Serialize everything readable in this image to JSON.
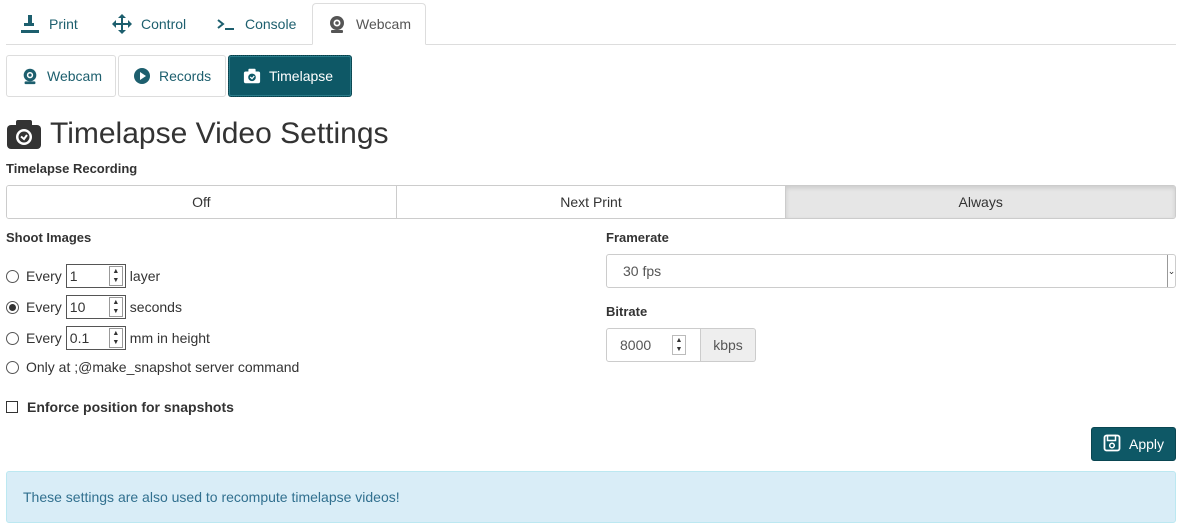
{
  "main_tabs": [
    {
      "label": "Print",
      "icon": "print-icon"
    },
    {
      "label": "Control",
      "icon": "move-arrows-icon"
    },
    {
      "label": "Console",
      "icon": "terminal-icon"
    },
    {
      "label": "Webcam",
      "icon": "webcam-icon",
      "active": true
    }
  ],
  "sub_tabs": [
    {
      "label": "Webcam",
      "icon": "webcam-icon"
    },
    {
      "label": "Records",
      "icon": "play-circle-icon"
    },
    {
      "label": "Timelapse",
      "icon": "camera-icon",
      "active": true
    }
  ],
  "title": "Timelapse Video Settings",
  "recording": {
    "label": "Timelapse Recording",
    "options": [
      "Off",
      "Next Print",
      "Always"
    ],
    "selected": "Always"
  },
  "shoot": {
    "label": "Shoot Images",
    "options": [
      {
        "prefix": "Every",
        "value": "1",
        "suffix": "layer",
        "checked": false
      },
      {
        "prefix": "Every",
        "value": "10",
        "suffix": "seconds",
        "checked": true
      },
      {
        "prefix": "Every",
        "value": "0.1",
        "suffix": "mm in height",
        "checked": false
      },
      {
        "text": "Only at ;@make_snapshot server command",
        "checked": false
      }
    ]
  },
  "enforce": {
    "label": "Enforce position for snapshots",
    "checked": false
  },
  "framerate": {
    "label": "Framerate",
    "value": "30 fps"
  },
  "bitrate": {
    "label": "Bitrate",
    "value": "8000",
    "unit": "kbps"
  },
  "apply_label": "Apply",
  "info_text": "These settings are also used to recompute timelapse videos!",
  "colors": {
    "accent": "#0e5866",
    "link": "#1d5f6e",
    "info_bg": "#d9edf7",
    "info_text": "#31708f"
  }
}
